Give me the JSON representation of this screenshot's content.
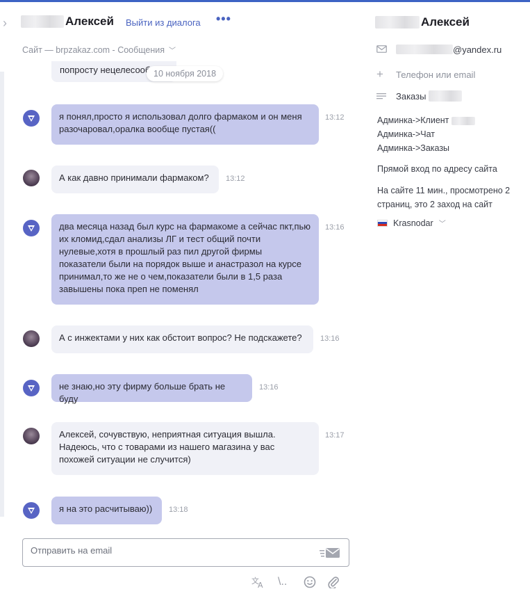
{
  "header": {
    "contact_name": "Алексей",
    "exit_label": "Выйти из диалога",
    "more_label": "•••",
    "source": "Сайт — brpzakaz.com - Сообщения"
  },
  "messages": {
    "partial_text": "попросту нецелесооб",
    "date_label": "10 ноября 2018",
    "items": [
      {
        "from": "bot",
        "text": "я понял,просто я использовал долго фармаком и он меня разочаровал,оралка вообще пустая((",
        "time": "13:12"
      },
      {
        "from": "user",
        "text": "А как давно принимали фармаком?",
        "time": "13:12"
      },
      {
        "from": "bot",
        "text": "два месяца назад был курс на фармакоме а сейчас пкт,пью их кломид,сдал анализы ЛГ и тест общий почти нулевые,хотя в прошлый раз пил другой фирмы показатели были на порядок выше и анастразол на курсе принимал,то же не о чем,показатели были в 1,5 раза завышены пока преп не поменял",
        "time": "13:16"
      },
      {
        "from": "user",
        "text": "А с инжектами у них как обстоит вопрос? Не подскажете?",
        "time": "13:16"
      },
      {
        "from": "bot",
        "text": "не знаю,но эту фирму больше брать не буду",
        "time": "13:16"
      },
      {
        "from": "user",
        "text": "Алексей, сочувствую, неприятная ситуация вышла. Надеюсь, что с товарами из нашего магазина у вас похожей ситуации не случится)",
        "time": "13:17"
      },
      {
        "from": "bot",
        "text": "я на это расчитываю))",
        "time": "13:18"
      }
    ]
  },
  "composer": {
    "placeholder": "Отправить на email"
  },
  "toolbar": {
    "translate_icon": "translate-icon",
    "snippet_label": "\\..",
    "emoji_icon": "emoji-icon",
    "attach_icon": "paperclip-icon"
  },
  "contact": {
    "name": "Алексей",
    "email_suffix": "@yandex.ru",
    "add_contact_placeholder": "Телефон или email",
    "orders_label": "Заказы",
    "links": [
      "Админка->Клиент",
      "Админка->Чат",
      "Админка->Заказы"
    ],
    "entry": "Прямой вход по адресу сайта",
    "visit_info": "На сайте 11 мин., просмотрено 2 страниц, это 2 заход на сайт",
    "city": "Krasnodar"
  },
  "colors": {
    "accent": "#4a63c0",
    "incoming_bubble": "#c5c8ec",
    "outgoing_bubble": "#f0f1f7",
    "top_bar": "#3d63c4"
  }
}
